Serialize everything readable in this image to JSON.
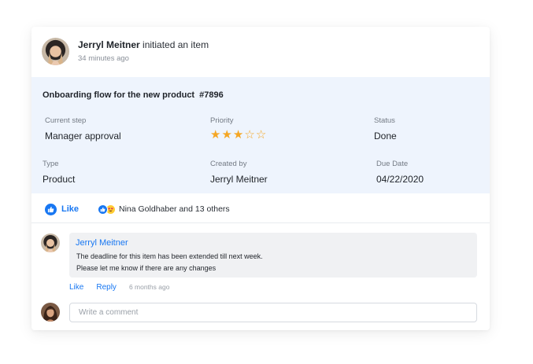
{
  "header": {
    "author": "Jerryl Meitner",
    "action": "initiated an item",
    "time": "34 minutes ago"
  },
  "item": {
    "title": "Onboarding flow for the new product",
    "number": "#7896",
    "fields": {
      "current_step": {
        "label": "Current step",
        "value": "Manager approval"
      },
      "priority": {
        "label": "Priority",
        "rating": 3,
        "max": 5
      },
      "status": {
        "label": "Status",
        "value": "Done"
      },
      "type": {
        "label": "Type",
        "value": "Product"
      },
      "created_by": {
        "label": "Created by",
        "value": "Jerryl Meitner"
      },
      "due_date": {
        "label": "Due Date",
        "value": "04/22/2020"
      }
    }
  },
  "likebar": {
    "like_label": "Like",
    "reactions_text": "Nina Goldhaber and 13 others",
    "reaction_icons": [
      "thumbs-up-icon",
      "heart-eyes-emoji-icon"
    ]
  },
  "comment": {
    "author": "Jerryl Meitner",
    "line1": "The deadline for this item has been extended till next week.",
    "line2": "Please let me know if there are any changes",
    "like_label": "Like",
    "reply_label": "Reply",
    "time": "6 months ago"
  },
  "compose": {
    "placeholder": "Write a comment"
  },
  "colors": {
    "accent": "#1877f2",
    "star": "#f5a623",
    "panel_bg": "#eef4fd"
  }
}
